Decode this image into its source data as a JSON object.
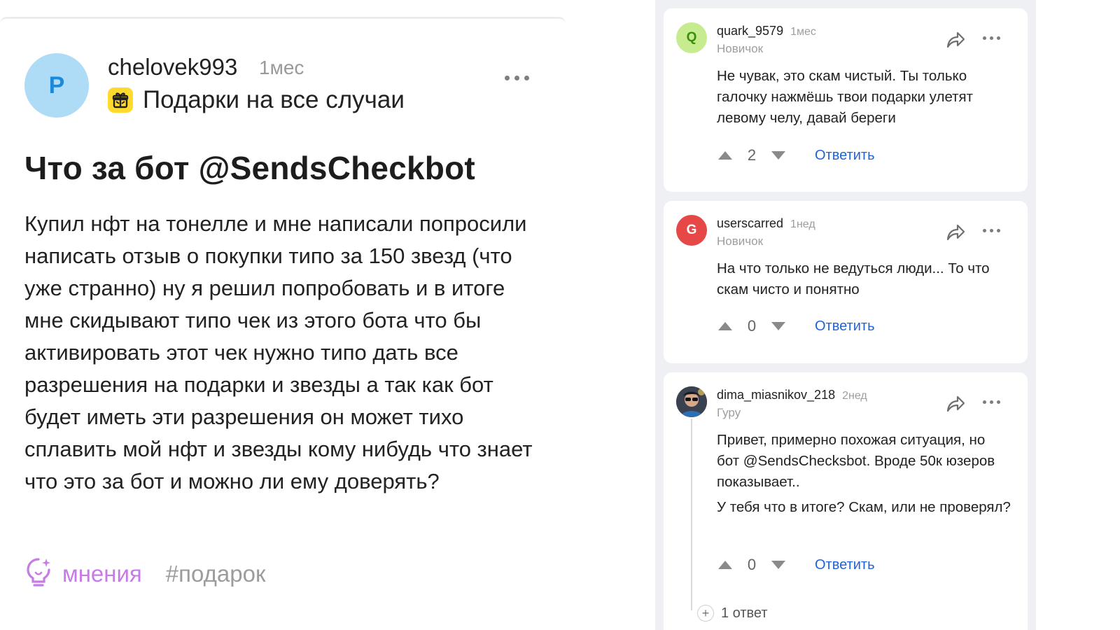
{
  "post": {
    "avatar_letter": "P",
    "author": "chelovek993",
    "time": "1мес",
    "group_name": "Подарки на все случаи",
    "title": "Что за бот @SendsCheckbot",
    "body": "Купил нфт на тонелле и мне написали попросили написать отзыв о покупки типо за 150 звезд (что уже странно) ну я решил попробовать и в итоге мне скидывают типо чек из этого бота что бы активировать этот чек нужно типо дать все разрешения на подарки и звезды а так как бот будет иметь эти разрешения он может тихо сплавить мой нфт и звезды кому нибудь что знает что это за бот и можно ли ему доверять?",
    "tag_opinions": "мнения",
    "tag_hash": "#подарок",
    "colors": {
      "avatar_bg": "#aedcf7",
      "avatar_fg": "#1c8ad8",
      "group_icon_bg": "#ffd92e",
      "opinions": "#c77be6"
    }
  },
  "comments": [
    {
      "avatar_letter": "Q",
      "avatar_bg": "#c6ec8f",
      "avatar_fg": "#3a8e0c",
      "author": "quark_9579",
      "time": "1мес",
      "rank": "Новичок",
      "text": "Не чувак, это скам чистый. Ты только галочку нажмёшь твои подарки улетят левому челу, давай береги",
      "votes": "2",
      "reply_label": "Ответить"
    },
    {
      "avatar_letter": "G",
      "avatar_bg": "#e64848",
      "avatar_fg": "#ffffff",
      "author": "userscarred",
      "time": "1нед",
      "rank": "Новичок",
      "text": "На что только не ведуться люди... То что скам чисто и понятно",
      "votes": "0",
      "reply_label": "Ответить"
    },
    {
      "author": "dima_miasnikov_218",
      "time": "2нед",
      "rank": "Гуру",
      "text_p1": "Привет, примерно похожая ситуация, но бот @SendsChecksbot. Вроде 50к юзеров показывает..",
      "text_p2": "У тебя что в итоге? Скам, или не проверял?",
      "votes": "0",
      "reply_label": "Ответить",
      "replies_label": "1 ответ"
    }
  ],
  "icons": [
    "more-dots-icon",
    "gift-icon",
    "bulb-icon",
    "share-icon",
    "upvote-icon",
    "downvote-icon",
    "plus-icon"
  ],
  "accent_link": "#1f63d8"
}
